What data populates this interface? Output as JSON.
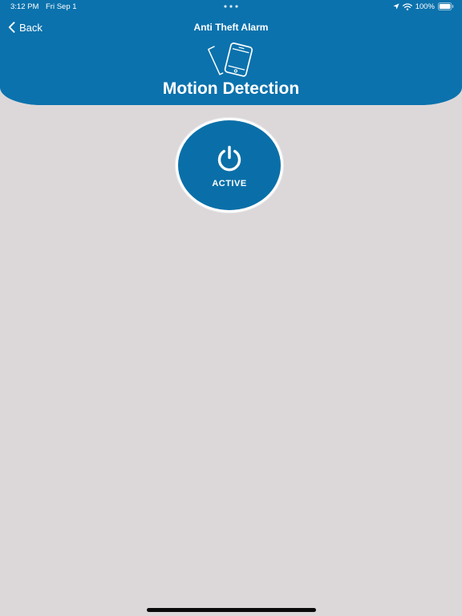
{
  "status_bar": {
    "time": "3:12 PM",
    "date": "Fri Sep 1",
    "battery": "100%"
  },
  "nav": {
    "back_label": "Back",
    "title": "Anti Theft Alarm"
  },
  "header": {
    "title": "Motion Detection",
    "icon": "phone-motion-icon"
  },
  "power_button": {
    "label": "ACTIVE",
    "icon": "power-icon"
  },
  "colors": {
    "accent": "#0b72ad",
    "background": "#dcd8da",
    "text_on_accent": "#ffffff"
  }
}
